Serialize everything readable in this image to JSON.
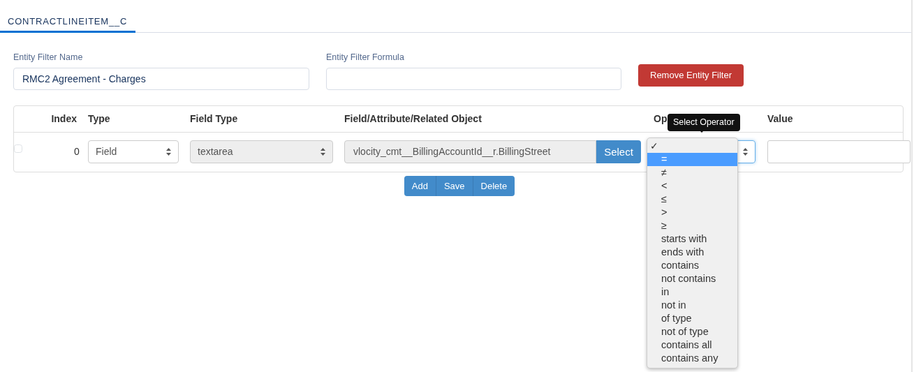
{
  "tabs": [
    {
      "label": "CONTRACTLINEITEM__C",
      "selected": true
    }
  ],
  "entity_filter_name": {
    "label": "Entity Filter Name",
    "value": "RMC2 Agreement - Charges"
  },
  "entity_filter_formula": {
    "label": "Entity Filter Formula"
  },
  "remove_button": "Remove Entity Filter",
  "table": {
    "columns": [
      "Index",
      "Type",
      "Field Type",
      "Field/Attribute/Related Object",
      "Op",
      "Value"
    ],
    "rows": [
      {
        "checked": false,
        "index": "0",
        "type": "Field",
        "field_type": "textarea",
        "field": "vlocity_cmt__BillingAccountId__r.BillingStreet",
        "select_button": "Select",
        "operator_focused": true
      }
    ]
  },
  "actions": [
    "Add",
    "Save",
    "Delete"
  ],
  "tooltip": "Select Operator",
  "operator_menu": {
    "check": "✓",
    "options": [
      {
        "label": "=",
        "highlighted": true
      },
      {
        "label": "≠",
        "highlighted": false
      },
      {
        "label": "<",
        "highlighted": false
      },
      {
        "label": "≤",
        "highlighted": false
      },
      {
        "label": ">",
        "highlighted": false
      },
      {
        "label": "≥",
        "highlighted": false
      },
      {
        "label": "starts with",
        "highlighted": false
      },
      {
        "label": "ends with",
        "highlighted": false
      },
      {
        "label": "contains",
        "highlighted": false
      },
      {
        "label": "not contains",
        "highlighted": false
      },
      {
        "label": "in",
        "highlighted": false
      },
      {
        "label": "not in",
        "highlighted": false
      },
      {
        "label": "of type",
        "highlighted": false
      },
      {
        "label": "not of type",
        "highlighted": false
      },
      {
        "label": "contains all",
        "highlighted": false
      },
      {
        "label": "contains any",
        "highlighted": false
      }
    ]
  }
}
